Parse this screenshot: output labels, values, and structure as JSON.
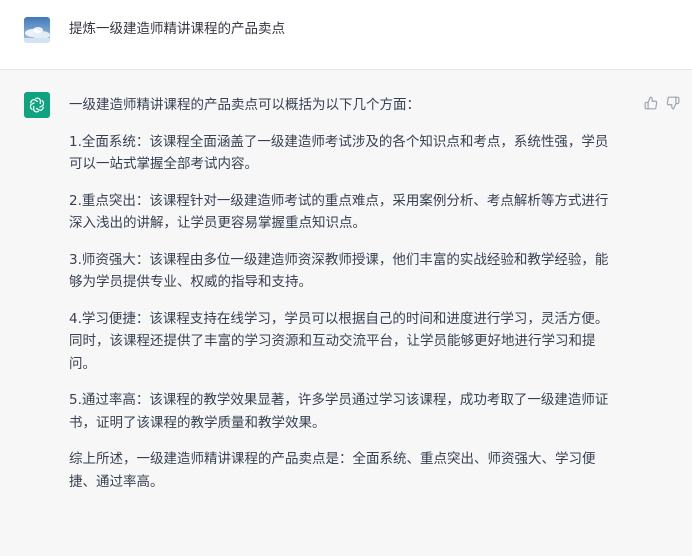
{
  "user_message": {
    "text": "提炼一级建造师精讲课程的产品卖点",
    "avatar_icon": "user-avatar-image"
  },
  "assistant_message": {
    "avatar_icon": "openai-logo-icon",
    "accent_color": "#10a37f",
    "paragraphs": [
      "一级建造师精讲课程的产品卖点可以概括为以下几个方面：",
      "1.全面系统：该课程全面涵盖了一级建造师考试涉及的各个知识点和考点，系统性强，学员\n可以一站式掌握全部考试内容。",
      "2.重点突出：该课程针对一级建造师考试的重点难点，采用案例分析、考点解析等方式进行\n深入浅出的讲解，让学员更容易掌握重点知识点。",
      "3.师资强大：该课程由多位一级建造师资深教师授课，他们丰富的实战经验和教学经验，能\n够为学员提供专业、权威的指导和支持。",
      "4.学习便捷：该课程支持在线学习，学员可以根据自己的时间和进度进行学习，灵活方便。\n同时，该课程还提供了丰富的学习资源和互动交流平台，让学员能够更好地进行学习和提\n问。",
      "5.通过率高：该课程的教学效果显著，许多学员通过学习该课程，成功考取了一级建造师证\n书，证明了该课程的教学质量和教学效果。",
      "综上所述，一级建造师精讲课程的产品卖点是：全面系统、重点突出、师资强大、学习便\n捷、通过率高。"
    ],
    "feedback": {
      "thumbs_up_icon": "thumbs-up-icon",
      "thumbs_down_icon": "thumbs-down-icon"
    }
  }
}
